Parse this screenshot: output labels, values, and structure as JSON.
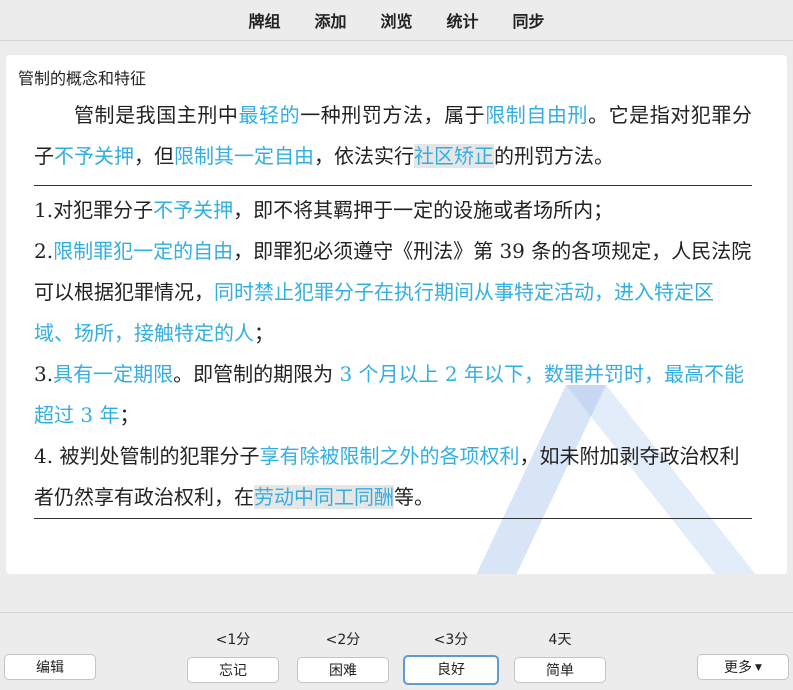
{
  "toolbar": {
    "items": [
      "牌组",
      "添加",
      "浏览",
      "统计",
      "同步"
    ]
  },
  "card": {
    "title": "管制的概念和特征",
    "intro": [
      {
        "text": "管制是我国主刑中",
        "style": ""
      },
      {
        "text": "最轻的",
        "style": "hl"
      },
      {
        "text": "一种刑罚方法，属于",
        "style": ""
      },
      {
        "text": "限制自由刑",
        "style": "hl"
      },
      {
        "text": "。它是指对犯罪分子",
        "style": ""
      },
      {
        "text": "不予关押",
        "style": "hl"
      },
      {
        "text": "，但",
        "style": ""
      },
      {
        "text": "限制其一定自由",
        "style": "hl"
      },
      {
        "text": "，依法实行",
        "style": ""
      },
      {
        "text": "社区矫正",
        "style": "hl grey"
      },
      {
        "text": "的刑罚方法。",
        "style": ""
      }
    ],
    "points": [
      [
        {
          "text": "1.对犯罪分子",
          "style": ""
        },
        {
          "text": "不予关押",
          "style": "hl"
        },
        {
          "text": "，即不将其羁押于一定的设施或者场所内；",
          "style": ""
        }
      ],
      [
        {
          "text": "2.",
          "style": ""
        },
        {
          "text": "限制罪犯一定的自由",
          "style": "hl"
        },
        {
          "text": "，即罪犯必须遵守《刑法》第 39 条的各项规定，人民法院可以根据犯罪情况，",
          "style": ""
        },
        {
          "text": "同时禁止犯罪分子在执行期间从事特定活动，进入特定区域、场所，接触特定的人",
          "style": "hl"
        },
        {
          "text": "；",
          "style": ""
        }
      ],
      [
        {
          "text": "3.",
          "style": ""
        },
        {
          "text": "具有一定期限",
          "style": "hl"
        },
        {
          "text": "。即管制的期限为 ",
          "style": ""
        },
        {
          "text": "3 个月以上 2 年以下，数罪并罚时，最高不能超过 3 年",
          "style": "hl"
        },
        {
          "text": "；",
          "style": ""
        }
      ],
      [
        {
          "text": "4. 被判处管制的犯罪分子",
          "style": ""
        },
        {
          "text": "享有除被限制之外的各项权利",
          "style": "hl"
        },
        {
          "text": "，如未附加剥夺政治权利者仍然享有政治权利，在",
          "style": ""
        },
        {
          "text": "劳动中同工同酬",
          "style": "hl grey"
        },
        {
          "text": "等。",
          "style": ""
        }
      ]
    ]
  },
  "review": {
    "edit_label": "编辑",
    "more_label": "更多",
    "more_arrow": "▼",
    "answers": [
      {
        "interval": "<1分",
        "label": "忘记",
        "active": false
      },
      {
        "interval": "<2分",
        "label": "困难",
        "active": false
      },
      {
        "interval": "<3分",
        "label": "良好",
        "active": true
      },
      {
        "interval": "4天",
        "label": "简单",
        "active": false
      }
    ]
  },
  "colors": {
    "highlight": "#33aee1",
    "grey_highlight": "#e6e6e6",
    "active_border": "#5b9bd8",
    "background": "#ececec"
  }
}
